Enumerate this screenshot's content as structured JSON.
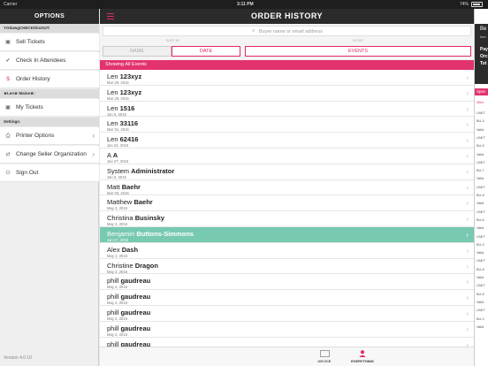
{
  "status_bar": {
    "carrier": "Carrier",
    "time": "3:11 PM",
    "battery": "74%"
  },
  "sidebar": {
    "title": "OPTIONS",
    "sections": [
      {
        "label": "YOdawgCHECKthisOUT:",
        "items": [
          {
            "label": "Sell Tickets",
            "icon": "ticket-icon"
          },
          {
            "label": "Check In Attendees",
            "icon": "check-icon"
          },
          {
            "label": "Order History",
            "icon": "dollar-icon",
            "active": true
          }
        ]
      },
      {
        "label": "★Len★ Maine★:",
        "items": [
          {
            "label": "My Tickets",
            "icon": "ticket-icon"
          }
        ]
      },
      {
        "label": "Settings:",
        "items": [
          {
            "label": "Printer Options",
            "icon": "printer-icon",
            "chevron": true
          },
          {
            "label": "Change Seller Organization",
            "icon": "swap-icon",
            "chevron": true
          },
          {
            "label": "Sign Out",
            "icon": "power-icon"
          }
        ]
      }
    ],
    "version": "Version 4.0.10"
  },
  "main": {
    "title": "ORDER HISTORY",
    "search_placeholder": "Buyer name or email address",
    "sort_by_label": "SORT BY",
    "filter_label": "FILTER",
    "sort_options": [
      "NAME",
      "DATE"
    ],
    "sort_selected": "DATE",
    "filter_options": [
      "EVENTS"
    ],
    "showing": "Showing All Events",
    "orders": [
      {
        "first": "Len",
        "last": "123xyz",
        "date": "Mar 29, 2016"
      },
      {
        "first": "Len",
        "last": "123xyz",
        "date": "Mar 29, 2016"
      },
      {
        "first": "Len",
        "last": "1516",
        "date": "Jan 5, 2016"
      },
      {
        "first": "Len",
        "last": "33116",
        "date": "Mar 31, 2016"
      },
      {
        "first": "Len",
        "last": "62416",
        "date": "Jun 24, 2016"
      },
      {
        "first": "A",
        "last": "A",
        "date": "Jun 27, 2016"
      },
      {
        "first": "System",
        "last": "Administrator",
        "date": "Jan 5, 2016"
      },
      {
        "first": "Matt",
        "last": "Baehr",
        "date": "Mar 25, 2016"
      },
      {
        "first": "Matthew",
        "last": "Baehr",
        "date": "May 2, 2016"
      },
      {
        "first": "Christina",
        "last": "Businsky",
        "date": "May 2, 2016"
      },
      {
        "first": "Benjamin",
        "last": "Buttons-Simmons",
        "date": "Jun 27, 2016",
        "selected": true
      },
      {
        "first": "Alex",
        "last": "Dash",
        "date": "May 2, 2016"
      },
      {
        "first": "Christine",
        "last": "Dragon",
        "date": "May 2, 2016"
      },
      {
        "first": "phill",
        "last": "gaudreau",
        "date": "May 2, 2016"
      },
      {
        "first": "phill",
        "last": "gaudreau",
        "date": "May 2, 2016"
      },
      {
        "first": "phill",
        "last": "gaudreau",
        "date": "May 2, 2016"
      },
      {
        "first": "phill",
        "last": "gaudreau",
        "date": "May 2, 2016"
      },
      {
        "first": "phill",
        "last": "gaudreau",
        "date": "May 2, 2016"
      }
    ],
    "tabs": [
      {
        "label": "DEVICE",
        "icon": "device-icon"
      },
      {
        "label": "EVERYTHING",
        "icon": "person-icon",
        "active": true
      }
    ]
  },
  "detail": {
    "header_lines": [
      "Be",
      "ban",
      "Pay",
      "Orc",
      "Tot"
    ],
    "pink_label": "Spec",
    "pink_text": "Wed",
    "lines": [
      "LIMIT",
      "BU-3",
      "Valid",
      "LIMIT",
      "BU-5",
      "Valid",
      "LIMIT",
      "BU-7",
      "Valid",
      "LIMIT",
      "BU-8",
      "Valid",
      "LIMIT",
      "BU-6",
      "Valid",
      "LIMIT",
      "BU-9",
      "Valid",
      "LIMIT",
      "BU-8",
      "Valid",
      "LIMIT",
      "BU-8",
      "Valid",
      "LIMIT",
      "BU-2",
      "Valid"
    ]
  }
}
